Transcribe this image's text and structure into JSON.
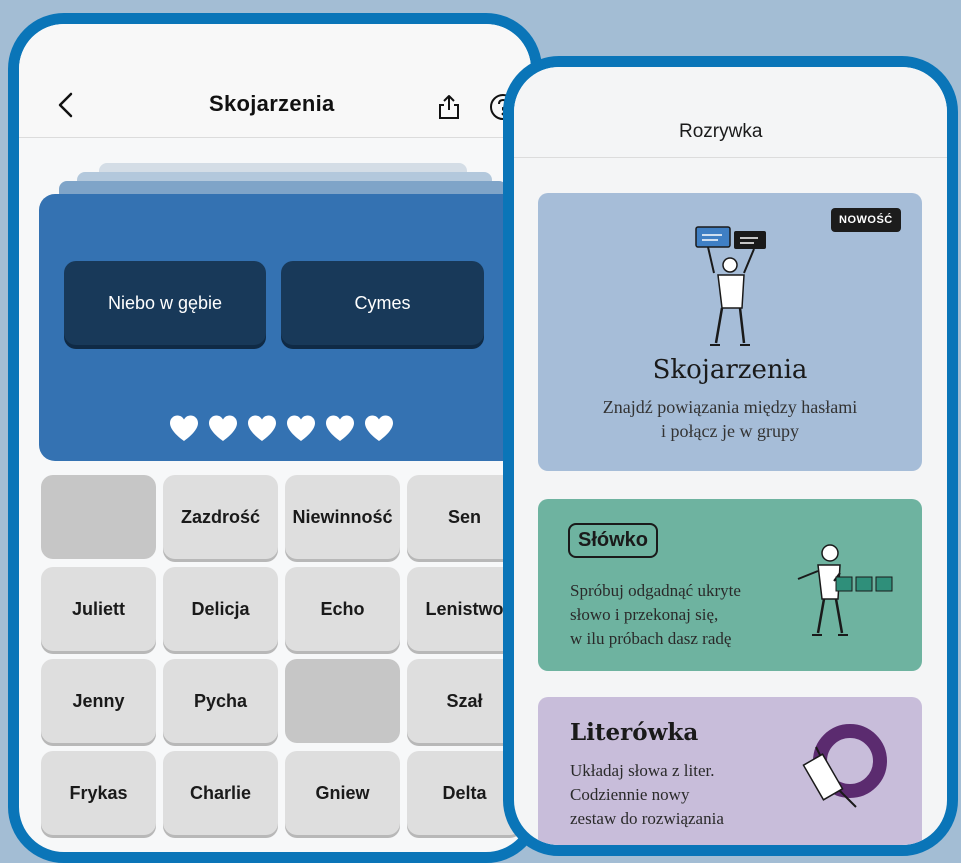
{
  "left_screen": {
    "title": "Skojarzenia",
    "back_icon": "chevron-left-icon",
    "share_icon": "share-icon",
    "help_icon": "help-circle-icon",
    "found_groups": [
      "Niebo w gębie",
      "Cymes"
    ],
    "lives": 6,
    "tiles": [
      [
        "",
        "Zazdrość",
        "Niewinność",
        "Sen"
      ],
      [
        "Juliett",
        "Delicja",
        "Echo",
        "Lenistwo"
      ],
      [
        "Jenny",
        "Pycha",
        "",
        "Szał"
      ],
      [
        "Frykas",
        "Charlie",
        "Gniew",
        "Delta"
      ]
    ]
  },
  "right_screen": {
    "title": "Rozrywka",
    "cards": [
      {
        "badge": "NOWOŚĆ",
        "title": "Skojarzenia",
        "desc": [
          "Znajdź powiązania między hasłami",
          "i połącz je w grupy"
        ]
      },
      {
        "title": "Słówko",
        "desc": [
          "Spróbuj odgadnąć ukryte",
          "słowo i przekonaj się,",
          "w ilu próbach dasz radę"
        ]
      },
      {
        "title": "Literówka",
        "desc": [
          "Układaj słowa z liter.",
          "Codziennie nowy",
          "zestaw do rozwiązania"
        ]
      }
    ]
  },
  "colors": {
    "frame": "#0a75b8",
    "board": "#3472b2",
    "found": "#183959",
    "card1": "#a6bdd8",
    "card2": "#6eb3a0",
    "card3": "#c8bdda"
  }
}
